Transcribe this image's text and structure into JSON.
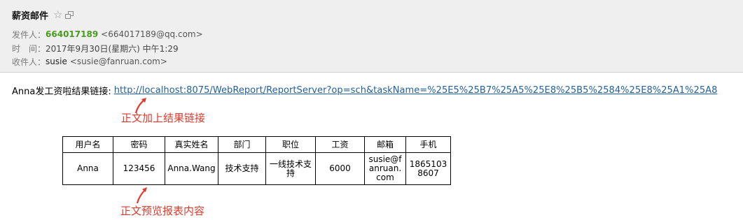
{
  "header": {
    "subject": "薪资邮件",
    "sender_label": "发件人：",
    "sender_name": "664017189",
    "sender_email": "<664017189@qq.com>",
    "time_label": "时　间：",
    "time_value": "2017年9月30日(星期六) 中午1:29",
    "recipient_label": "收件人：",
    "recipient_name": "susie",
    "recipient_email": "<susie@fanruan.com>"
  },
  "body": {
    "link_prefix": "Anna发工资啦结果链接:",
    "link_url": "http://localhost:8075/WebReport/ReportServer?op=sch&taskName=%25E5%25B7%25A5%25E8%25B5%2584%25E8%25A1%25A8",
    "annotation_link": "正文加上结果链接",
    "annotation_table": "正文预览报表内容",
    "annotation_color": "#e03a2e"
  },
  "table": {
    "headers": [
      "用户名",
      "密码",
      "真实姓名",
      "部门",
      "职位",
      "工资",
      "邮箱",
      "手机"
    ],
    "rows": [
      [
        "Anna",
        "123456",
        "Anna.Wang",
        "技术支持",
        "一线技术支持",
        "6000",
        "susie@fanruan.com",
        "18651038607"
      ]
    ]
  },
  "icons": {
    "star": "star-icon",
    "window": "new-window-icon",
    "arrow": "annotation-arrow-icon"
  }
}
